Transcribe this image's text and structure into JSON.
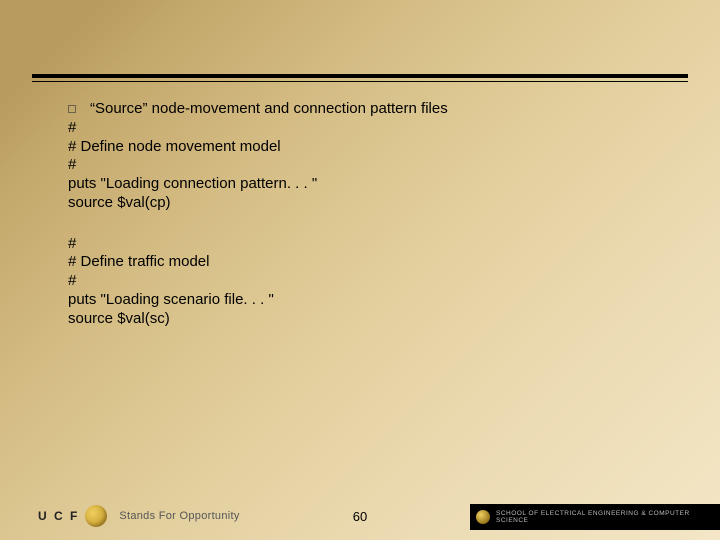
{
  "bullet_heading": "“Source” node-movement and connection pattern files",
  "code_block_1": [
    "#",
    "# Define node movement model",
    "#",
    "puts \"Loading connection pattern. . . \"",
    "source $val(cp)"
  ],
  "code_block_2": [
    "#",
    "# Define traffic model",
    "#",
    "puts \"Loading scenario file. . . \"",
    "source $val(sc)"
  ],
  "footer": {
    "ucf": "U C F",
    "stands_for": "Stands For Opportunity",
    "page_number": "60",
    "school": "SCHOOL OF ELECTRICAL ENGINEERING & COMPUTER SCIENCE"
  }
}
